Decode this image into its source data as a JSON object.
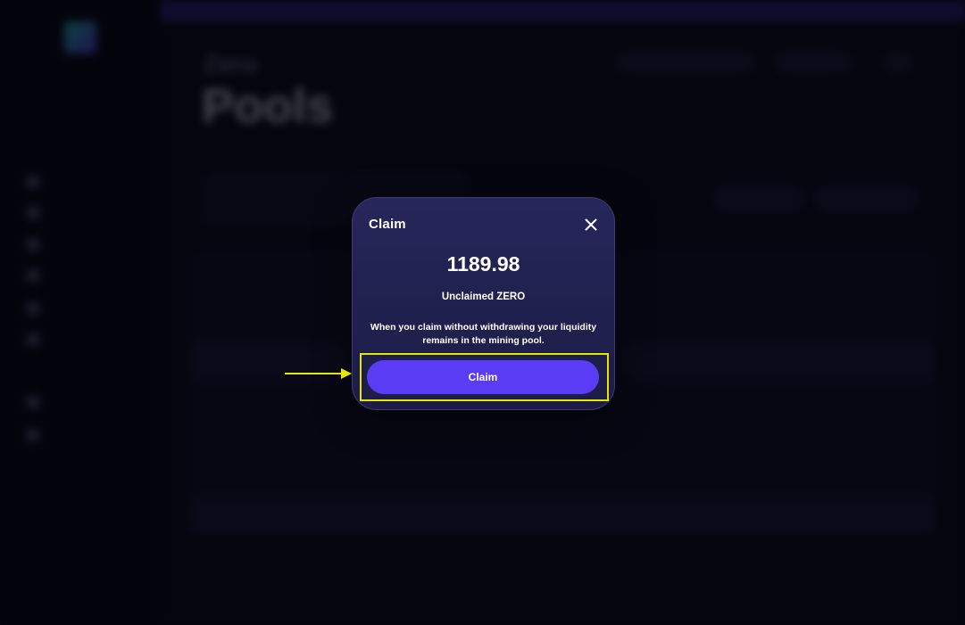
{
  "modal": {
    "title": "Claim",
    "amount": "1189.98",
    "amount_label": "Unclaimed ZERO",
    "info_text": "When you claim without withdrawing your liquidity remains in the mining pool.",
    "claim_button_label": "Claim"
  },
  "background": {
    "page_title": "Pools",
    "brand": "Zero"
  },
  "icons": {
    "close": "close-icon",
    "annotation_arrow": "arrow-right-icon"
  },
  "colors": {
    "primary_button": "#5a3cf5",
    "modal_bg": "#262659",
    "highlight": "#e6e600",
    "topbar": "#2c2480"
  }
}
